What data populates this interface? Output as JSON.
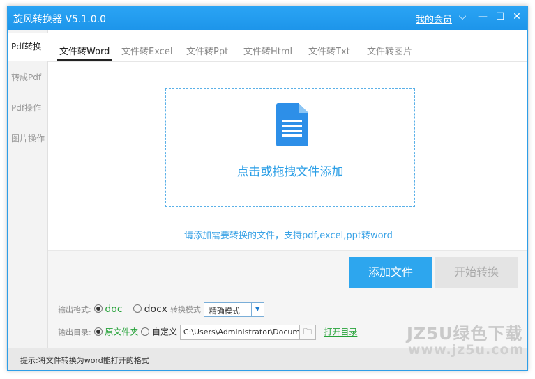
{
  "app": {
    "title": "旋风转换器 V5.1.0.0",
    "member_link": "我的会员"
  },
  "window_controls": {
    "dropdown": "⌵",
    "minimize": "—",
    "maximize": "☐",
    "close": "✕"
  },
  "sidebar": {
    "items": [
      {
        "label": "Pdf转换",
        "active": true
      },
      {
        "label": "转成Pdf"
      },
      {
        "label": "Pdf操作"
      },
      {
        "label": "图片操作"
      }
    ]
  },
  "tabs": [
    {
      "label": "文件转Word",
      "active": true
    },
    {
      "label": "文件转Excel"
    },
    {
      "label": "文件转Ppt"
    },
    {
      "label": "文件转Html"
    },
    {
      "label": "文件转Txt"
    },
    {
      "label": "文件转图片"
    }
  ],
  "drop_zone": {
    "text": "点击或拖拽文件添加",
    "icon": "document-icon"
  },
  "hint": "请添加需要转换的文件，支持pdf,excel,ppt转word",
  "buttons": {
    "add": "添加文件",
    "start": "开始转换"
  },
  "output_format": {
    "label": "输出格式:",
    "options": [
      "doc",
      "docx"
    ],
    "selected": "doc",
    "mode_label": "转换模式",
    "mode_value": "精确模式",
    "mode_arrow": "▼"
  },
  "output_dir": {
    "label": "输出目录:",
    "option_original": "原文件夹",
    "option_custom": "自定义",
    "selected": "原文件夹",
    "path": "C:\\Users\\Administrator\\Documents",
    "folder_icon": "🗀",
    "open_link": "打开目录"
  },
  "status": {
    "text": "提示:将文件转换为word能打开的格式"
  },
  "watermark": {
    "line1": "JZ5U绿色下载",
    "line2": "www.jz5u.com"
  },
  "colors": {
    "accent": "#2da6ee",
    "title_bar": "#1d95ea",
    "green": "#27a33a"
  }
}
